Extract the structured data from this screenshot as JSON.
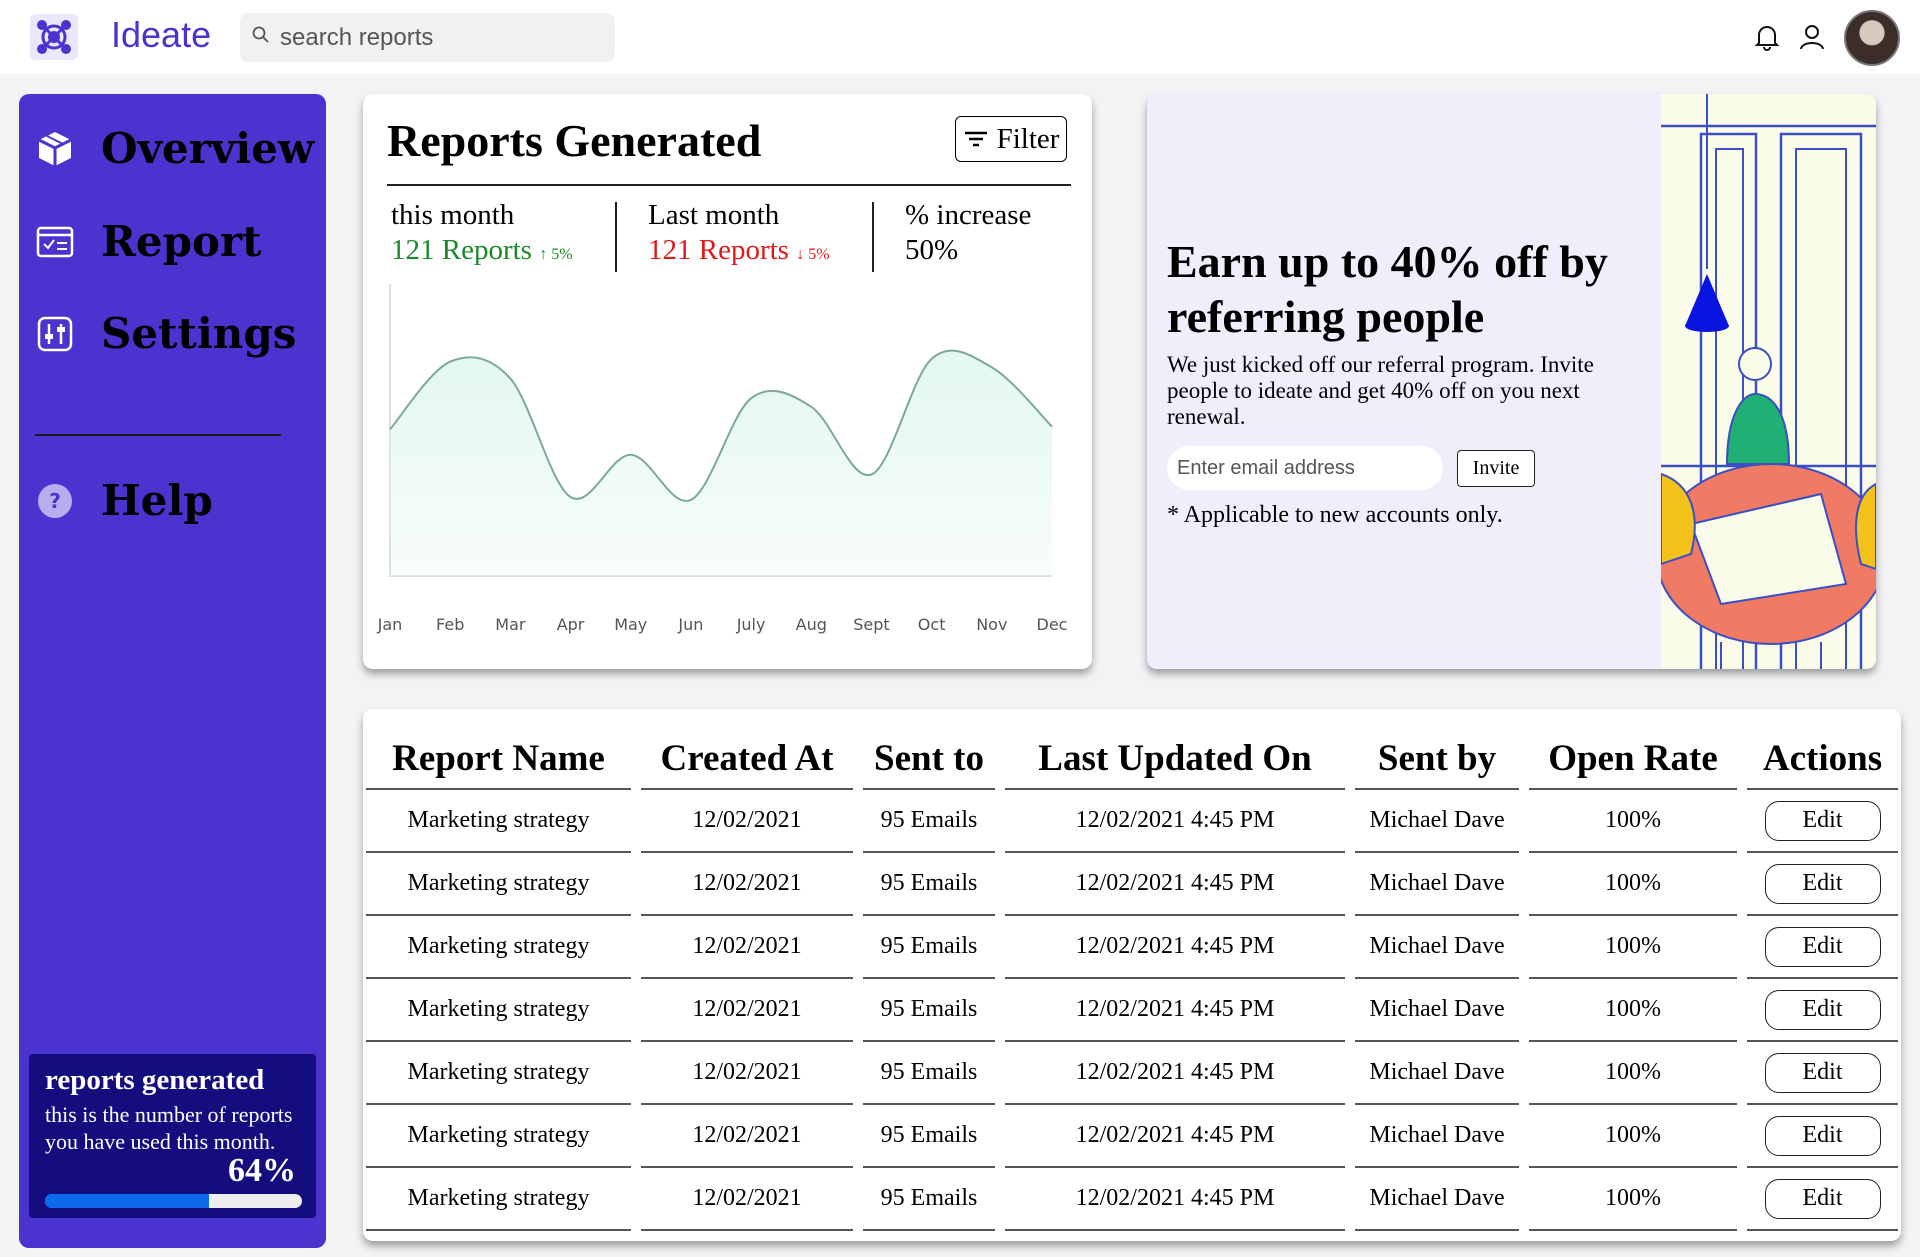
{
  "app": {
    "name": "Ideate",
    "logo_icon": "atom-logo-icon",
    "brand_color": "#4a33cf"
  },
  "search": {
    "placeholder": "search reports",
    "icon": "search-icon"
  },
  "header_icons": [
    "bell-icon",
    "user-icon",
    "avatar"
  ],
  "sidebar": {
    "items": [
      {
        "label": "Overview",
        "icon": "cube-icon"
      },
      {
        "label": "Report",
        "icon": "report-icon"
      },
      {
        "label": "Settings",
        "icon": "sliders-icon"
      },
      {
        "label": "Help",
        "icon": "help-icon"
      }
    ],
    "usage": {
      "title": "reports generated",
      "description": "this is the number of reports you have used this month.",
      "percent_label": "64%",
      "percent": 64
    }
  },
  "reports_card": {
    "title": "Reports Generated",
    "filter_label": "Filter",
    "stats": [
      {
        "label": "this month",
        "value": "121 Reports",
        "delta": "↑ 5%",
        "trend": "up"
      },
      {
        "label": "Last month",
        "value": "121 Reports",
        "delta": "↓ 5%",
        "trend": "down"
      },
      {
        "label": "% increase",
        "value": "50%"
      }
    ]
  },
  "chart_data": {
    "type": "area",
    "categories": [
      "Jan",
      "Feb",
      "Mar",
      "Apr",
      "May",
      "Jun",
      "July",
      "Aug",
      "Sept",
      "Oct",
      "Nov",
      "Dec"
    ],
    "values": [
      52,
      76,
      70,
      28,
      43,
      27,
      63,
      60,
      36,
      77,
      74,
      53
    ],
    "ylim": [
      0,
      100
    ],
    "line_color": "#7aa995",
    "fill_color": "#e3f7f1",
    "grid": false,
    "title": "",
    "xlabel": "",
    "ylabel": ""
  },
  "promo": {
    "title": "Earn up to 40% off by referring people",
    "body": "We just kicked off our referral program. Invite people to ideate and get 40% off on you next renewal.",
    "email_placeholder": "Enter email address",
    "invite_label": "Invite",
    "note": "* Applicable to new accounts only.",
    "illustration": "people-at-table-illustration"
  },
  "table": {
    "headers": [
      "Report Name",
      "Created At",
      "Sent to",
      "Last Updated On",
      "Sent by",
      "Open Rate",
      "Actions"
    ],
    "rows": [
      [
        "Marketing strategy",
        "12/02/2021",
        "95 Emails",
        "12/02/2021 4:45 PM",
        "Michael Dave",
        "100%",
        "Edit"
      ],
      [
        "Marketing strategy",
        "12/02/2021",
        "95 Emails",
        "12/02/2021 4:45 PM",
        "Michael Dave",
        "100%",
        "Edit"
      ],
      [
        "Marketing strategy",
        "12/02/2021",
        "95 Emails",
        "12/02/2021 4:45 PM",
        "Michael Dave",
        "100%",
        "Edit"
      ],
      [
        "Marketing strategy",
        "12/02/2021",
        "95 Emails",
        "12/02/2021 4:45 PM",
        "Michael Dave",
        "100%",
        "Edit"
      ],
      [
        "Marketing strategy",
        "12/02/2021",
        "95 Emails",
        "12/02/2021 4:45 PM",
        "Michael Dave",
        "100%",
        "Edit"
      ],
      [
        "Marketing strategy",
        "12/02/2021",
        "95 Emails",
        "12/02/2021 4:45 PM",
        "Michael Dave",
        "100%",
        "Edit"
      ],
      [
        "Marketing strategy",
        "12/02/2021",
        "95 Emails",
        "12/02/2021 4:45 PM",
        "Michael Dave",
        "100%",
        "Edit"
      ]
    ]
  }
}
